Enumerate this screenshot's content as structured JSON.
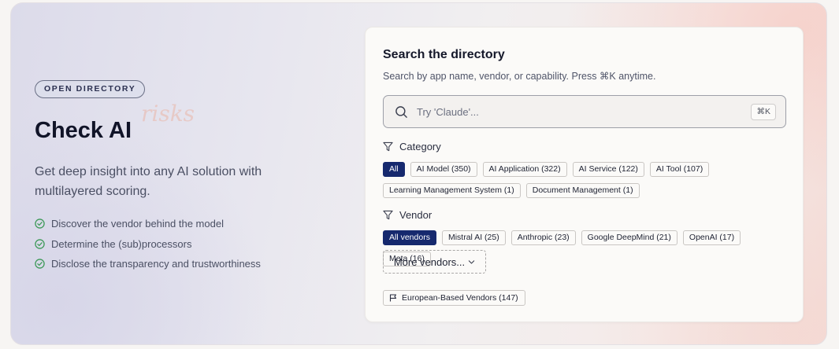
{
  "hero": {
    "badge": "OPEN DIRECTORY",
    "ghost_word": "risks",
    "title": "Check AI",
    "subtitle": "Get deep insight into any AI solution with multilayered scoring.",
    "features": [
      "Discover the vendor behind the model",
      "Determine the (sub)processors",
      "Disclose the transparency and trustworthiness"
    ]
  },
  "directory": {
    "title": "Search the directory",
    "subtitle": "Search by app name, vendor, or capability. Press ⌘K anytime.",
    "search": {
      "placeholder": "Try 'Claude'...",
      "shortcut": "⌘K"
    },
    "category": {
      "label": "Category",
      "chips": [
        {
          "label": "All",
          "active": true
        },
        {
          "label": "AI Model (350)",
          "active": false
        },
        {
          "label": "AI Application (322)",
          "active": false
        },
        {
          "label": "AI Service (122)",
          "active": false
        },
        {
          "label": "AI Tool (107)",
          "active": false
        },
        {
          "label": "Learning Management System (1)",
          "active": false
        },
        {
          "label": "Document Management (1)",
          "active": false
        }
      ]
    },
    "vendor": {
      "label": "Vendor",
      "chips": [
        {
          "label": "All vendors",
          "active": true
        },
        {
          "label": "Mistral AI (25)",
          "active": false
        },
        {
          "label": "Anthropic (23)",
          "active": false
        },
        {
          "label": "Google DeepMind (21)",
          "active": false
        },
        {
          "label": "OpenAI (17)",
          "active": false
        },
        {
          "label": "Meta (16)",
          "active": false
        }
      ],
      "more_label": "More vendors..."
    },
    "european_filter": "European-Based Vendors (147)"
  },
  "colors": {
    "accent": "#16296e",
    "check": "#3f9a5a"
  },
  "icons": [
    "check-circle-icon",
    "search-icon",
    "filter-icon",
    "chevron-down-icon",
    "flag-icon"
  ]
}
